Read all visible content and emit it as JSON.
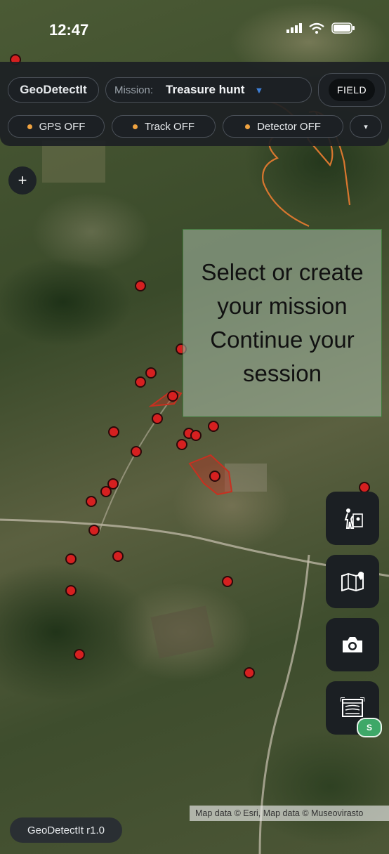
{
  "status_bar": {
    "time": "12:47"
  },
  "header": {
    "app_name": "GeoDetectIt",
    "mission_label": "Mission:",
    "mission_value": "Treasure hunt",
    "mode_button": "FIELD"
  },
  "toggles": [
    {
      "label": "GPS OFF"
    },
    {
      "label": "Track OFF"
    },
    {
      "label": "Detector OFF"
    }
  ],
  "more_toggle": "▾",
  "zoom_in": "+",
  "tooltip": {
    "text": "Select or create your mission Continue your session"
  },
  "fab_buttons": [
    {
      "icon": "hiker-map-icon"
    },
    {
      "icon": "map-pin-icon"
    },
    {
      "icon": "camera-icon"
    },
    {
      "icon": "scan-map-icon"
    }
  ],
  "sync_badge": "S",
  "attribution": "Map data © Esri, Map data © Museovirasto",
  "version": "GeoDetectIt r1.0",
  "colors": {
    "toggle_dot": "#f0a340",
    "marker": "#d62020",
    "badge": "#3ea868",
    "hint_stroke": "#d9772f"
  }
}
